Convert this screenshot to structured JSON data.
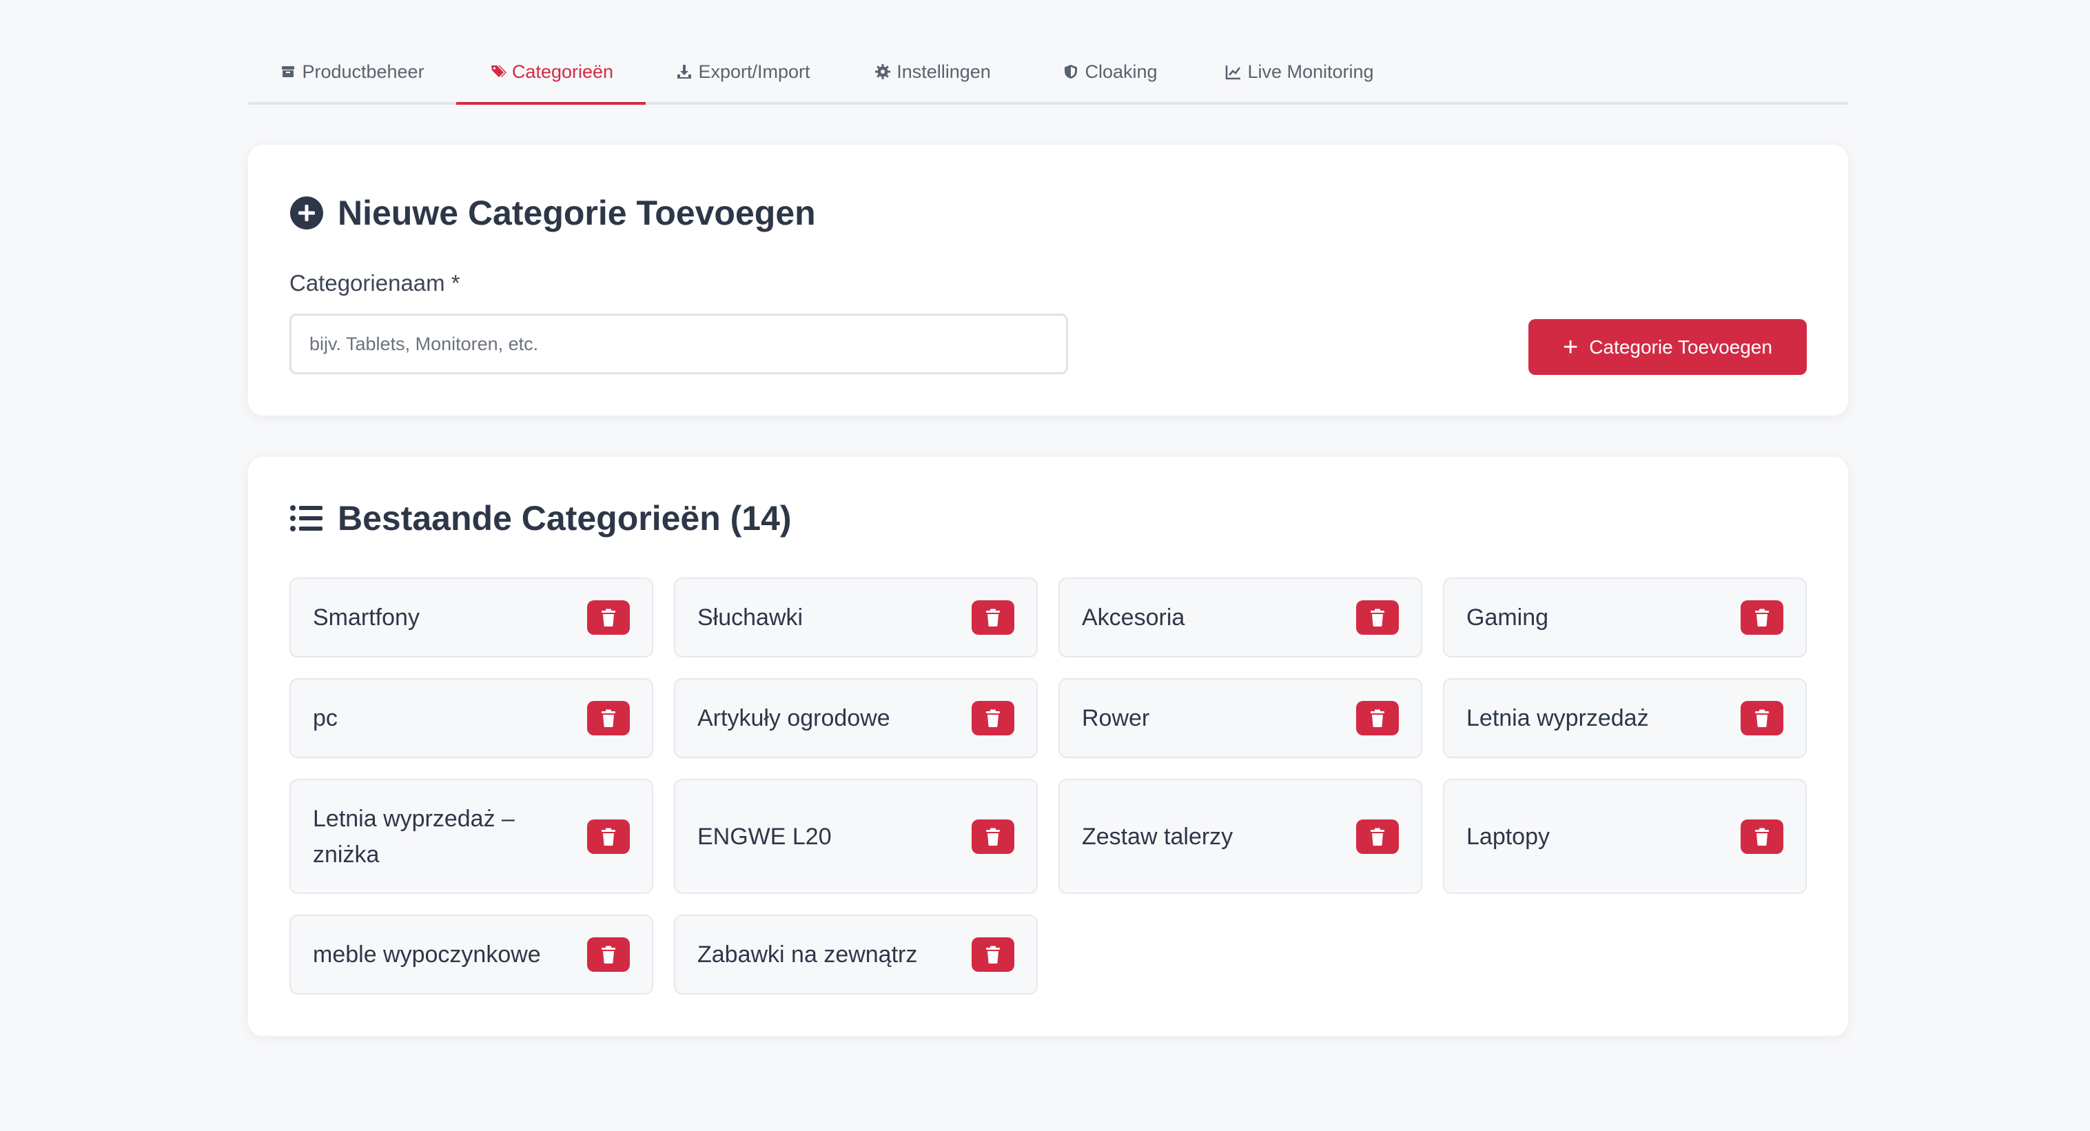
{
  "tabs": [
    {
      "label": "Productbeheer",
      "icon": "box-icon"
    },
    {
      "label": "Categorieën",
      "icon": "tags-icon"
    },
    {
      "label": "Export/Import",
      "icon": "download-icon"
    },
    {
      "label": "Instellingen",
      "icon": "gear-icon"
    },
    {
      "label": "Cloaking",
      "icon": "shield-icon"
    },
    {
      "label": "Live Monitoring",
      "icon": "chart-line-icon"
    }
  ],
  "active_tab": "Categorieën",
  "new_category": {
    "title": "Nieuwe Categorie Toevoegen",
    "field_label": "Categorienaam *",
    "input_value": "",
    "placeholder": "bijv. Tablets, Monitoren, etc.",
    "button_label": "Categorie Toevoegen"
  },
  "existing": {
    "title": "Bestaande Categorieën (14)",
    "categories": [
      "Smartfony",
      "Słuchawki",
      "Akcesoria",
      "Gaming",
      "pc",
      "Artykuły ogrodowe",
      "Rower",
      "Letnia wyprzedaż",
      "Letnia wyprzedaż – zniżka",
      "ENGWE L20",
      "Zestaw talerzy",
      "Laptopy",
      "meble wypoczynkowe",
      "Zabawki na zewnątrz"
    ]
  },
  "colors": {
    "accent": "#d32a44",
    "text": "#2d3748",
    "background": "#f7f8fa"
  }
}
